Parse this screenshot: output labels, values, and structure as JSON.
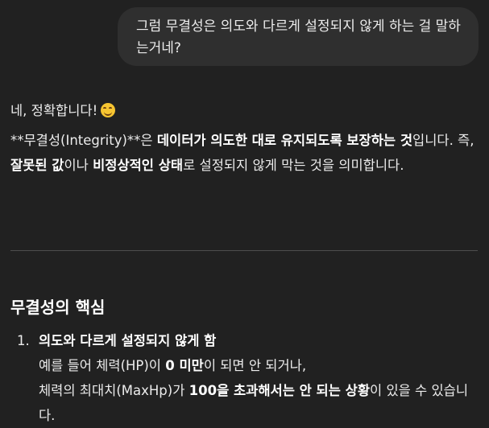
{
  "user_message": "그럼 무결성은 의도와 다르게 설정되지 않게 하는 걸 말하는거네?",
  "assistant": {
    "greeting": "네, 정확합니다!",
    "greeting_emoji": "smiling-face-emoji",
    "para": {
      "t1": "**무결성(Integrity)**은 ",
      "b1": "데이터가 의도한 대로 유지되도록 보장하는 것",
      "t2": "입니다. 즉, ",
      "b2": "잘못된 값",
      "t3": "이나 ",
      "b3": "비정상적인 상태",
      "t4": "로 설정되지 않게 막는 것을 의미합니다."
    },
    "section_heading": "무결성의 핵심",
    "list": [
      {
        "number": "1.",
        "title": "의도와 다르게 설정되지 않게 함",
        "line1_t1": "예를 들어 체력(HP)이 ",
        "line1_b1": "0 미만",
        "line1_t2": "이 되면 안 되거나,",
        "line2_t1": "체력의 최대치(MaxHp)가 ",
        "line2_b1": "100을 초과해서는 안 되는 상황",
        "line2_t2": "이 있을 수 있습니다."
      }
    ]
  }
}
